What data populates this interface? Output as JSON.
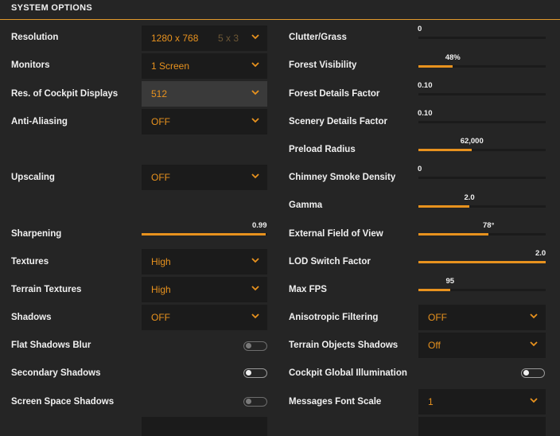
{
  "header": {
    "title": "SYSTEM OPTIONS"
  },
  "accent_color": "#e8921e",
  "left": {
    "resolution": {
      "label": "Resolution",
      "value": "1280 x 768",
      "extra": "5 x 3"
    },
    "monitors": {
      "label": "Monitors",
      "value": "1 Screen"
    },
    "cockpit_res": {
      "label": "Res. of Cockpit Displays",
      "value": "512"
    },
    "antialiasing": {
      "label": "Anti-Aliasing",
      "value": "OFF"
    },
    "upscaling": {
      "label": "Upscaling",
      "value": "OFF"
    },
    "sharpening": {
      "label": "Sharpening",
      "value": "0.99",
      "fraction": 0.99
    },
    "textures": {
      "label": "Textures",
      "value": "High"
    },
    "terrain_textures": {
      "label": "Terrain Textures",
      "value": "High"
    },
    "shadows": {
      "label": "Shadows",
      "value": "OFF"
    },
    "flat_shadows_blur": {
      "label": "Flat Shadows Blur",
      "on": false
    },
    "secondary_shadows": {
      "label": "Secondary Shadows",
      "on": false
    },
    "screen_space_shadows": {
      "label": "Screen Space Shadows",
      "on": false
    }
  },
  "right": {
    "clutter": {
      "label": "Clutter/Grass",
      "value": "0",
      "fraction": 0.0
    },
    "forest_visibility": {
      "label": "Forest Visibility",
      "value": "48%",
      "fraction": 0.27
    },
    "forest_details": {
      "label": "Forest Details Factor",
      "value": "0.10",
      "fraction": 0.0
    },
    "scenery_details": {
      "label": "Scenery Details Factor",
      "value": "0.10",
      "fraction": 0.0
    },
    "preload_radius": {
      "label": "Preload Radius",
      "value": "62,000",
      "fraction": 0.42
    },
    "chimney_smoke": {
      "label": "Chimney Smoke Density",
      "value": "0",
      "fraction": 0.0
    },
    "gamma": {
      "label": "Gamma",
      "value": "2.0",
      "fraction": 0.4
    },
    "efov": {
      "label": "External Field of View",
      "value": "78°",
      "fraction": 0.55
    },
    "lod_switch": {
      "label": "LOD Switch Factor",
      "value": "2.0",
      "fraction": 1.0
    },
    "max_fps": {
      "label": "Max FPS",
      "value": "95",
      "fraction": 0.25
    },
    "anisotropic": {
      "label": "Anisotropic Filtering",
      "value": "OFF"
    },
    "terrain_objects_shadows": {
      "label": "Terrain Objects Shadows",
      "value": "Off"
    },
    "cockpit_gi": {
      "label": "Cockpit Global Illumination",
      "on": false
    },
    "messages_font_scale": {
      "label": "Messages Font Scale",
      "value": "1"
    }
  }
}
